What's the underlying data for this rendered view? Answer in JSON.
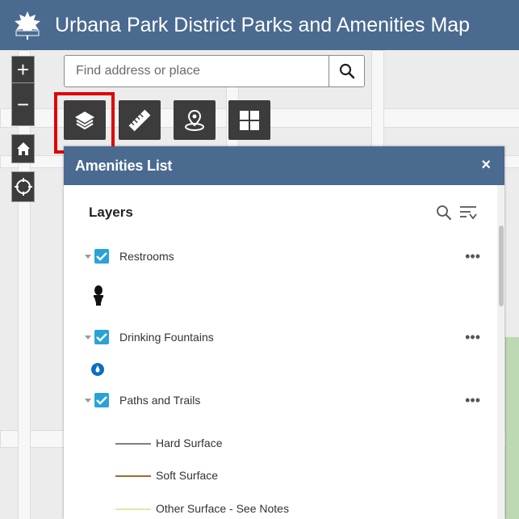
{
  "header": {
    "title": "Urbana Park District Parks and Amenities Map"
  },
  "search": {
    "placeholder": "Find address or place"
  },
  "panel": {
    "title": "Amenities List",
    "close": "×",
    "section": "Layers",
    "layers": [
      {
        "name": "Restrooms",
        "checked": true,
        "icon": "toilet-icon"
      },
      {
        "name": "Drinking Fountains",
        "checked": true,
        "icon": "water-drop-icon"
      },
      {
        "name": "Paths and Trails",
        "checked": true
      }
    ],
    "legend": [
      {
        "label": "Hard Surface",
        "color": "#7f7f7f"
      },
      {
        "label": "Soft Surface",
        "color": "#9c6b2e"
      },
      {
        "label": "Other Surface - See Notes",
        "color": "#dfe8a6"
      }
    ],
    "more": "•••"
  },
  "colors": {
    "header": "#4a6a90",
    "accent": "#29a3d6",
    "highlight": "#e00000",
    "tool_bg": "#3c3c3c"
  }
}
